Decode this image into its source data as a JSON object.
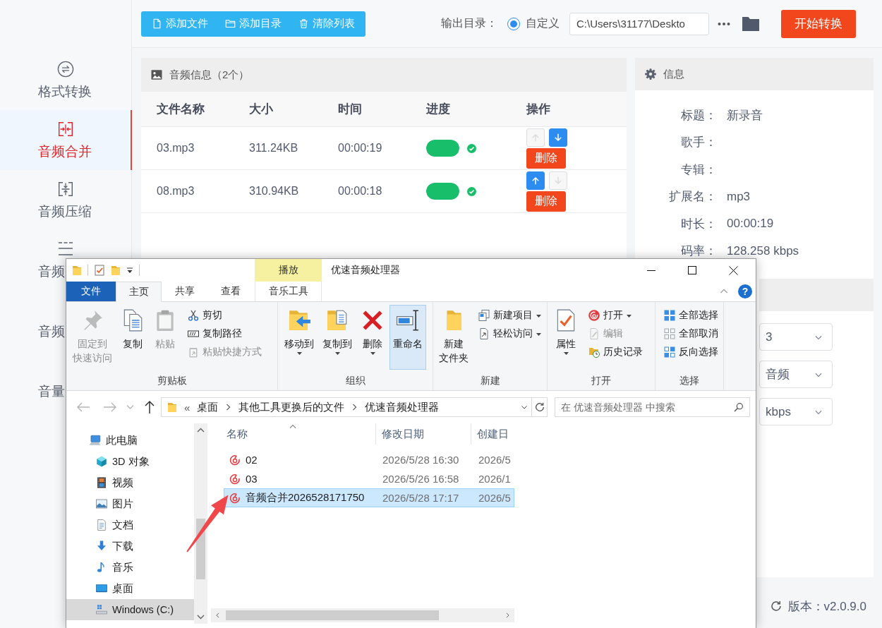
{
  "app": {
    "sidebar": {
      "items": [
        {
          "label": "格式转换",
          "selected": false
        },
        {
          "label": "音频合并",
          "selected": true
        },
        {
          "label": "音频压缩",
          "selected": false
        },
        {
          "label": "音频",
          "selected": false
        },
        {
          "label": "音频",
          "selected": false
        },
        {
          "label": "音量",
          "selected": false
        }
      ]
    },
    "toolbar": {
      "actions": [
        "添加文件",
        "添加目录",
        "清除列表"
      ],
      "output_label": "输出目录：",
      "output_options": [
        {
          "label": "自定义",
          "selected": true
        }
      ],
      "output_path": "C:\\Users\\31177\\Deskto",
      "start_button": "开始转换"
    },
    "audio_panel": {
      "title": "音频信息（2个）",
      "columns": [
        "文件名称",
        "大小",
        "时间",
        "进度",
        "操作"
      ],
      "rows": [
        {
          "name": "03.mp3",
          "size": "311.24KB",
          "time": "00:00:19",
          "level": 1,
          "done": true,
          "up_disabled": true,
          "down_disabled": false,
          "delete": "删除"
        },
        {
          "name": "08.mp3",
          "size": "310.94KB",
          "time": "00:00:18",
          "level": 1,
          "done": true,
          "up_disabled": false,
          "down_disabled": true,
          "delete": "删除"
        }
      ]
    },
    "info_panel": {
      "title": "信息",
      "fields": [
        {
          "label": "标题：",
          "value": "新录音"
        },
        {
          "label": "歌手："
        },
        {
          "label": "专辑："
        },
        {
          "label": "扩展名：",
          "value": "mp3"
        },
        {
          "label": "时长：",
          "value": "00:00:19"
        },
        {
          "label": "码率：",
          "value": "128.258 kbps"
        }
      ]
    },
    "settings_panel": {
      "selects": [
        {
          "value": "3"
        },
        {
          "value": "音频"
        },
        {
          "value": "kbps"
        }
      ]
    },
    "version": "版本：v2.0.9.0"
  },
  "explorer": {
    "title": "优速音频处理器",
    "contextual_tab": "播放",
    "tabs": [
      {
        "label": "文件",
        "kind": "backstage",
        "selected": false
      },
      {
        "label": "主页",
        "kind": "tab",
        "selected": true
      },
      {
        "label": "共享",
        "kind": "tab",
        "selected": false
      },
      {
        "label": "查看",
        "kind": "tab",
        "selected": false
      },
      {
        "label": "音乐工具",
        "kind": "contextual",
        "selected": false
      }
    ],
    "help": "?",
    "ribbon_groups": [
      {
        "label": "剪贴板",
        "commands": [
          {
            "kind": "large",
            "lines": [
              "固定到",
              "快速访问"
            ],
            "disabled": true,
            "dropdown": false,
            "hovered": false
          },
          {
            "kind": "large",
            "lines": [
              "复制"
            ],
            "disabled": false,
            "dropdown": false,
            "hovered": false
          },
          {
            "kind": "large",
            "lines": [
              "粘贴"
            ],
            "disabled": true,
            "dropdown": false,
            "hovered": false
          },
          {
            "kind": "small",
            "label": "剪切",
            "disabled": false,
            "dropdown": false,
            "hovered": false
          },
          {
            "kind": "small",
            "label": "复制路径",
            "disabled": false,
            "dropdown": false,
            "hovered": false
          },
          {
            "kind": "small",
            "label": "粘贴快捷方式",
            "disabled": true,
            "dropdown": false,
            "hovered": false
          }
        ]
      },
      {
        "label": "组织",
        "commands": [
          {
            "kind": "large",
            "lines": [
              "移动到"
            ],
            "disabled": false,
            "dropdown": true,
            "hovered": false
          },
          {
            "kind": "large",
            "lines": [
              "复制到"
            ],
            "disabled": false,
            "dropdown": true,
            "hovered": false
          },
          {
            "kind": "large",
            "lines": [
              "删除"
            ],
            "disabled": false,
            "dropdown": true,
            "hovered": false
          },
          {
            "kind": "large",
            "lines": [
              "重命名"
            ],
            "disabled": false,
            "dropdown": false,
            "hovered": true
          }
        ]
      },
      {
        "label": "新建",
        "commands": [
          {
            "kind": "large",
            "lines": [
              "新建",
              "文件夹"
            ],
            "disabled": false,
            "dropdown": false,
            "hovered": false
          },
          {
            "kind": "small",
            "label": "新建项目",
            "disabled": false,
            "dropdown": true,
            "hovered": false
          },
          {
            "kind": "small",
            "label": "轻松访问",
            "disabled": false,
            "dropdown": true,
            "hovered": false
          }
        ]
      },
      {
        "label": "打开",
        "commands": [
          {
            "kind": "large",
            "lines": [
              "属性"
            ],
            "disabled": false,
            "dropdown": true,
            "hovered": false
          },
          {
            "kind": "small",
            "label": "打开",
            "disabled": false,
            "dropdown": true,
            "hovered": false
          },
          {
            "kind": "small",
            "label": "编辑",
            "disabled": true,
            "dropdown": false,
            "hovered": false
          },
          {
            "kind": "small",
            "label": "历史记录",
            "disabled": false,
            "dropdown": false,
            "hovered": false
          }
        ]
      },
      {
        "label": "选择",
        "commands": [
          {
            "kind": "small",
            "label": "全部选择",
            "disabled": false,
            "dropdown": false,
            "hovered": false
          },
          {
            "kind": "small",
            "label": "全部取消",
            "disabled": false,
            "dropdown": false,
            "hovered": false
          },
          {
            "kind": "small",
            "label": "反向选择",
            "disabled": false,
            "dropdown": false,
            "hovered": false
          }
        ]
      }
    ],
    "history_buttons": {
      "back_disabled": true,
      "forward_disabled": true,
      "recent_disabled": true,
      "up_disabled": false
    },
    "address": {
      "overflow": "«",
      "crumbs": [
        "桌面",
        "其他工具更换后的文件",
        "优速音频处理器"
      ]
    },
    "search": {
      "placeholder": "在 优速音频处理器 中搜索"
    },
    "nav": {
      "items": [
        {
          "label": "此电脑",
          "selected": false,
          "children": [
            {
              "label": "3D 对象",
              "selected": false
            },
            {
              "label": "视频",
              "selected": false
            },
            {
              "label": "图片",
              "selected": false
            },
            {
              "label": "文档",
              "selected": false
            },
            {
              "label": "下载",
              "selected": false
            },
            {
              "label": "音乐",
              "selected": false
            },
            {
              "label": "桌面",
              "selected": false
            },
            {
              "label": "Windows (C:)",
              "selected": true
            }
          ]
        }
      ]
    },
    "files": {
      "columns": [
        {
          "label": "名称",
          "sorted": true
        },
        {
          "label": "修改日期",
          "sorted": false
        },
        {
          "label": "创建日",
          "sorted": false
        }
      ],
      "rows": [
        {
          "name": "02",
          "modified": "2026/5/28 16:30",
          "created": "2026/5",
          "selected": false
        },
        {
          "name": "03",
          "modified": "2026/5/26 16:58",
          "created": "2026/1",
          "selected": false
        },
        {
          "name": "音频合并2026528171750",
          "modified": "2026/5/28 17:17",
          "created": "2026/5",
          "selected": true
        }
      ]
    }
  }
}
